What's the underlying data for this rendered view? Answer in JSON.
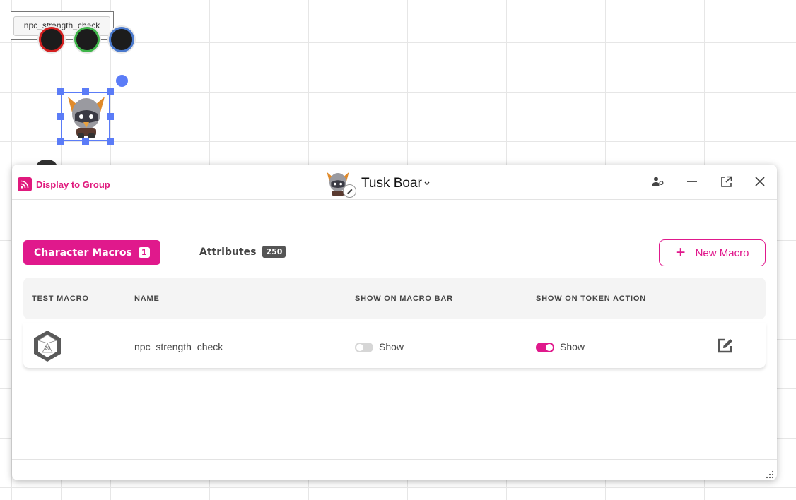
{
  "canvas": {
    "tooltip_text": "npc_strength_check",
    "bar_colors": [
      "#d32020",
      "#3fb54a",
      "#4a79cc"
    ]
  },
  "dialog": {
    "display_to_group": "Display to Group",
    "character_name": "Tusk Boar",
    "tabs": {
      "macros_label": "Character Macros",
      "macros_count": "1",
      "attributes_label": "Attributes",
      "attributes_count": "250"
    },
    "new_macro_label": "New Macro",
    "table": {
      "headers": [
        "TEST MACRO",
        "NAME",
        "SHOW ON MACRO BAR",
        "SHOW ON TOKEN ACTION"
      ],
      "rows": [
        {
          "die_label": "20",
          "name": "npc_strength_check",
          "macro_bar_label": "Show",
          "macro_bar_on": false,
          "token_action_label": "Show",
          "token_action_on": true
        }
      ]
    },
    "accent_color": "#e0198c"
  }
}
